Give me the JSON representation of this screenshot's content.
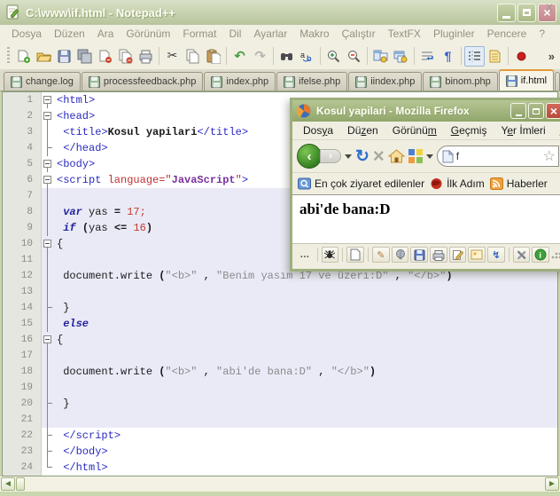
{
  "colors": {
    "jsbg": "#eaeaf7",
    "tag": "#2a2ac0",
    "attr": "#c03030",
    "value": "#7b2f9e",
    "kw": "#23239d",
    "num": "#c23b2e",
    "str": "#8a8a8a",
    "active-tab-accent": "#e49a3a",
    "npp-title-green": "#b7c59c",
    "ff-title-green": "#90a66a",
    "close-red": "#b84a3c",
    "toolbar-beige": "#f1efe2"
  },
  "npp": {
    "title": "C:\\www\\if.html - Notepad++",
    "menu_items": [
      "Dosya",
      "Düzen",
      "Ara",
      "Görünüm",
      "Format",
      "Dil",
      "Ayarlar",
      "Makro",
      "Çalıştır",
      "TextFX",
      "Pluginler",
      "Pencere",
      "?"
    ],
    "menubar_close": "X",
    "toolbar_overflow": "»",
    "toolbar_groups": [
      [
        "new-file",
        "open-file",
        "save",
        "save-all",
        "close-document",
        "close-all-documents",
        "print"
      ],
      [
        "cut",
        "copy",
        "paste"
      ],
      [
        "undo",
        "redo"
      ],
      [
        "find",
        "replace"
      ],
      [
        "zoom-in",
        "zoom-out"
      ],
      [
        "sync-vertical",
        "sync-horizontal"
      ],
      [
        "word-wrap",
        "show-all-characters"
      ],
      [
        "indent-guide",
        "document-map"
      ],
      [
        "record-macro"
      ]
    ],
    "toolbar_pressed": [
      "indent-guide"
    ],
    "tabs": [
      "change.log",
      "processfeedback.php",
      "index.php",
      "ifelse.php",
      "iindex.php",
      "binom.php",
      "if.html"
    ],
    "active_tab": "if.html",
    "tab_nav": [
      "<",
      ">"
    ]
  },
  "editor": {
    "lines": [
      {
        "num": 1,
        "fold": "box",
        "zone": "html",
        "tokens": [
          [
            "tag",
            "<html>"
          ]
        ]
      },
      {
        "num": 2,
        "fold": "box",
        "zone": "html",
        "tokens": [
          [
            "tag",
            "<head>"
          ]
        ]
      },
      {
        "num": 3,
        "fold": "line",
        "zone": "html",
        "tokens": [
          [
            "plain",
            " "
          ],
          [
            "tag",
            "<title>"
          ],
          [
            "bold",
            "Kosul yapilari"
          ],
          [
            "tag",
            "</title>"
          ]
        ]
      },
      {
        "num": 4,
        "fold": "tick",
        "zone": "html",
        "tokens": [
          [
            "plain",
            " "
          ],
          [
            "tag",
            "</head>"
          ]
        ]
      },
      {
        "num": 5,
        "fold": "box",
        "zone": "html",
        "tokens": [
          [
            "tag",
            "<body>"
          ]
        ]
      },
      {
        "num": 6,
        "fold": "box",
        "zone": "html",
        "tokens": [
          [
            "tag",
            "<script "
          ],
          [
            "attr",
            "language"
          ],
          [
            "attr",
            "=\""
          ],
          [
            "value",
            "JavaScript"
          ],
          [
            "attr",
            "\""
          ],
          [
            "tag",
            ">"
          ]
        ]
      },
      {
        "num": 7,
        "fold": "line",
        "zone": "js",
        "tokens": []
      },
      {
        "num": 8,
        "fold": "line",
        "zone": "js",
        "tokens": [
          [
            "plain",
            " "
          ],
          [
            "kw",
            "var"
          ],
          [
            "plain",
            " yas "
          ],
          [
            "op",
            "= "
          ],
          [
            "num",
            "17"
          ],
          [
            "num",
            ";"
          ]
        ]
      },
      {
        "num": 9,
        "fold": "line",
        "zone": "js",
        "tokens": [
          [
            "plain",
            " "
          ],
          [
            "kw",
            "if"
          ],
          [
            "plain",
            " "
          ],
          [
            "op",
            "("
          ],
          [
            "plain",
            "yas "
          ],
          [
            "op",
            "<= "
          ],
          [
            "num",
            "16"
          ],
          [
            "op",
            ")"
          ]
        ]
      },
      {
        "num": 10,
        "fold": "box",
        "zone": "js",
        "tokens": [
          [
            "plain",
            "{"
          ]
        ]
      },
      {
        "num": 11,
        "fold": "line",
        "zone": "js",
        "tokens": []
      },
      {
        "num": 12,
        "fold": "line",
        "zone": "js",
        "tokens": [
          [
            "plain",
            " document.write "
          ],
          [
            "op",
            "("
          ],
          [
            "str",
            "\"<b>\""
          ],
          [
            "plain",
            " , "
          ],
          [
            "str",
            "\"Benim yasım 17 ve üzeri:D\""
          ],
          [
            "plain",
            " , "
          ],
          [
            "str",
            "\"</b>\""
          ],
          [
            "op",
            ")"
          ]
        ]
      },
      {
        "num": 13,
        "fold": "line",
        "zone": "js",
        "tokens": []
      },
      {
        "num": 14,
        "fold": "tick",
        "zone": "js",
        "tokens": [
          [
            "plain",
            " }"
          ]
        ]
      },
      {
        "num": 15,
        "fold": "line",
        "zone": "js",
        "tokens": [
          [
            "plain",
            " "
          ],
          [
            "kw",
            "else"
          ]
        ]
      },
      {
        "num": 16,
        "fold": "box",
        "zone": "js",
        "tokens": [
          [
            "plain",
            "{"
          ]
        ]
      },
      {
        "num": 17,
        "fold": "line",
        "zone": "js",
        "tokens": []
      },
      {
        "num": 18,
        "fold": "line",
        "zone": "js",
        "tokens": [
          [
            "plain",
            " document.write "
          ],
          [
            "op",
            "("
          ],
          [
            "str",
            "\"<b>\""
          ],
          [
            "plain",
            " , "
          ],
          [
            "str",
            "\"abi'de bana:D\""
          ],
          [
            "plain",
            " , "
          ],
          [
            "str",
            "\"</b>\""
          ],
          [
            "op",
            ")"
          ]
        ]
      },
      {
        "num": 19,
        "fold": "line",
        "zone": "js",
        "tokens": []
      },
      {
        "num": 20,
        "fold": "tick",
        "zone": "js",
        "tokens": [
          [
            "plain",
            " }"
          ]
        ]
      },
      {
        "num": 21,
        "fold": "line",
        "zone": "js",
        "tokens": []
      },
      {
        "num": 22,
        "fold": "tick",
        "zone": "html",
        "tokens": [
          [
            "plain",
            " "
          ],
          [
            "tag",
            "</script>"
          ]
        ]
      },
      {
        "num": 23,
        "fold": "tick",
        "zone": "html",
        "tokens": [
          [
            "plain",
            " "
          ],
          [
            "tag",
            "</body>"
          ]
        ]
      },
      {
        "num": 24,
        "fold": "end",
        "zone": "html",
        "tokens": [
          [
            "plain",
            " "
          ],
          [
            "tag",
            "</html>"
          ]
        ]
      }
    ]
  },
  "firefox": {
    "title": "Kosul yapilari - Mozilla Firefox",
    "menu_items": [
      {
        "label": "Dosya",
        "mnemonic": "y"
      },
      {
        "label": "Düzen",
        "mnemonic": "z"
      },
      {
        "label": "Görünüm",
        "mnemonic": "m"
      },
      {
        "label": "Geçmiş",
        "mnemonic": "G"
      },
      {
        "label": "Yer İmleri",
        "mnemonic": "e"
      },
      {
        "label": "Araçlar",
        "mnemonic": "A"
      }
    ],
    "nav": {
      "back": "‹",
      "forward": "›",
      "reload": "↻",
      "stop": "×",
      "star": "☆",
      "url_text": "f"
    },
    "bookmarks": [
      {
        "icon": "most-visited-icon",
        "label": "En çok ziyaret edilenler"
      },
      {
        "icon": "getting-started-icon",
        "label": "İlk Adım"
      },
      {
        "icon": "rss-icon",
        "label": "Haberler"
      }
    ],
    "content_text": "abi'de bana:D",
    "addonbar": [
      "ellipsis",
      "bug",
      "new-page",
      "pencil",
      "globe",
      "save-page",
      "print-page",
      "edit-note",
      "image",
      "lightning",
      "web-tools",
      "info"
    ]
  }
}
